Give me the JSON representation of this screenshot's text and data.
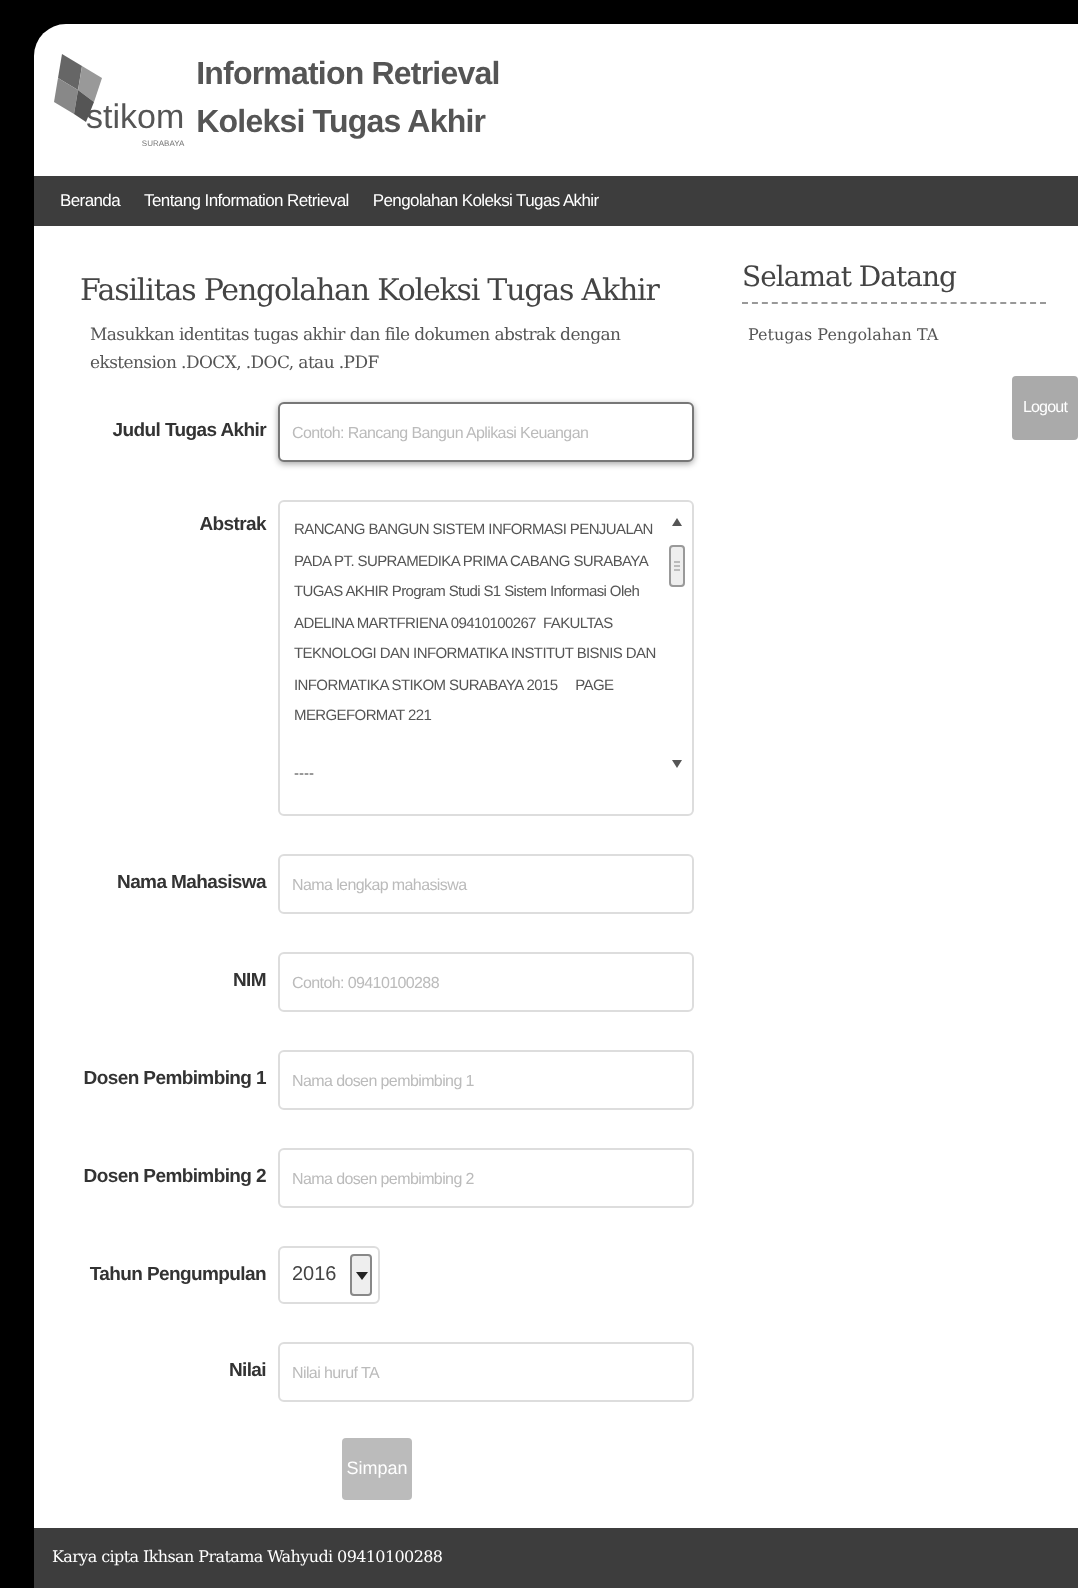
{
  "header": {
    "logo_text": "stikom",
    "logo_subtext": "SURABAYA",
    "title_lines": [
      "Information Retrieval",
      "Koleksi Tugas Akhir"
    ]
  },
  "nav": {
    "items": [
      {
        "label": "Beranda"
      },
      {
        "label": "Tentang Information Retrieval"
      },
      {
        "label": "Pengolahan Koleksi Tugas Akhir"
      }
    ]
  },
  "main": {
    "title": "Fasilitas Pengolahan Koleksi Tugas Akhir",
    "description": "Masukkan identitas tugas akhir dan file dokumen abstrak dengan ekstension .DOCX, .DOC, atau .PDF",
    "fields": [
      {
        "kind": "text",
        "label": "Judul Tugas Akhir",
        "placeholder": "Contoh: Rancang Bangun Aplikasi Keuangan",
        "focused": true
      },
      {
        "kind": "textarea",
        "label": "Abstrak",
        "value_lines": [
          "RANCANG BANGUN SISTEM INFORMASI PENJUALAN",
          "PADA PT. SUPRAMEDIKA PRIMA CABANG SURABAYA",
          "TUGAS AKHIR Program Studi S1 Sistem Informasi Oleh",
          "ADELINA MARTFRIENA 09410100267  FAKULTAS",
          "TEKNOLOGI DAN INFORMATIKA INSTITUT BISNIS DAN",
          "INFORMATIKA STIKOM SURABAYA 2015     PAGE",
          "MERGEFORMAT 221"
        ],
        "trailing_text": "----",
        "focused": false
      },
      {
        "kind": "text",
        "label": "Nama Mahasiswa",
        "placeholder": "Nama lengkap mahasiswa",
        "focused": false
      },
      {
        "kind": "text",
        "label": "NIM",
        "placeholder": "Contoh: 09410100288",
        "focused": false
      },
      {
        "kind": "text",
        "label": "Dosen Pembimbing 1",
        "placeholder": "Nama dosen pembimbing 1",
        "focused": false
      },
      {
        "kind": "text",
        "label": "Dosen Pembimbing 2",
        "placeholder": "Nama dosen pembimbing 2",
        "focused": false
      },
      {
        "kind": "select",
        "label": "Tahun Pengumpulan",
        "value": "2016",
        "focused": false
      },
      {
        "kind": "text",
        "label": "Nilai",
        "placeholder": "Nilai huruf TA",
        "focused": false
      }
    ],
    "submit": {
      "label": "Simpan",
      "disabled": true
    }
  },
  "sidebar": {
    "title": "Selamat Datang",
    "user": "Petugas Pengolahan TA",
    "logout": "Logout"
  },
  "footer": {
    "text": "Karya cipta Ikhsan Pratama Wahyudi 09410100288"
  }
}
